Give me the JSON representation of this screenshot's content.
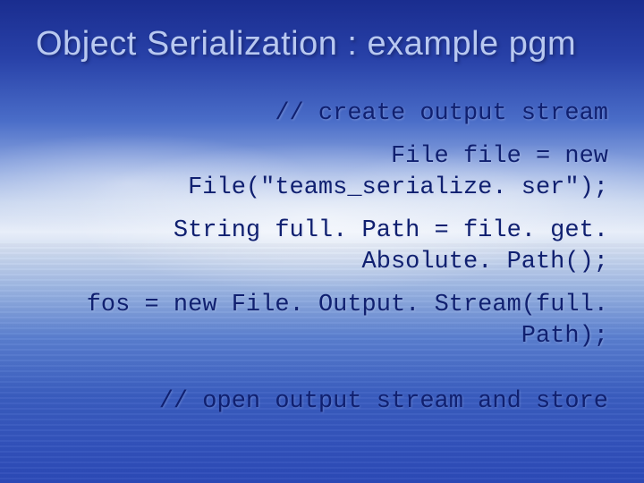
{
  "slide": {
    "title": "Object Serialization : example pgm",
    "code": {
      "l1": "// create output stream",
      "l2": "File file = new File(\"teams_serialize. ser\");",
      "l3": "String full. Path = file. get. Absolute. Path();",
      "l4": "fos = new File. Output. Stream(full. Path);",
      "footer": "// open output stream and store"
    }
  }
}
